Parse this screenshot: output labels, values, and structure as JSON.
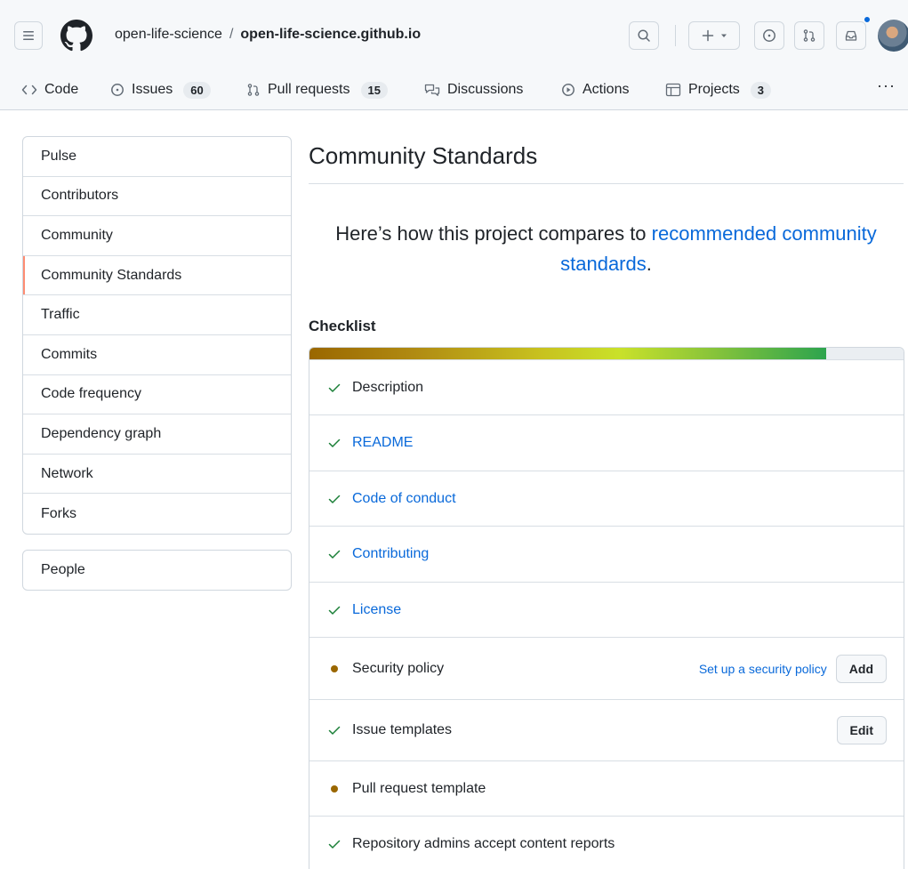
{
  "header": {
    "owner": "open-life-science",
    "separator": "/",
    "repo": "open-life-science.github.io"
  },
  "repo_nav": {
    "code": "Code",
    "issues": "Issues",
    "issues_count": "60",
    "pull_requests": "Pull requests",
    "pull_requests_count": "15",
    "discussions": "Discussions",
    "actions": "Actions",
    "projects": "Projects",
    "projects_count": "3",
    "more": "···"
  },
  "sidebar": {
    "items": [
      {
        "label": "Pulse"
      },
      {
        "label": "Contributors"
      },
      {
        "label": "Community"
      },
      {
        "label": "Community Standards"
      },
      {
        "label": "Traffic"
      },
      {
        "label": "Commits"
      },
      {
        "label": "Code frequency"
      },
      {
        "label": "Dependency graph"
      },
      {
        "label": "Network"
      },
      {
        "label": "Forks"
      }
    ],
    "people": "People"
  },
  "main": {
    "title": "Community Standards",
    "intro_prefix": "Here’s how this project compares to ",
    "intro_link": "recommended community standards",
    "intro_suffix": ".",
    "checklist_heading": "Checklist",
    "progress": 0.87,
    "items": [
      {
        "label": "Description",
        "status": "done"
      },
      {
        "label": "README",
        "status": "done"
      },
      {
        "label": "Code of conduct",
        "status": "done"
      },
      {
        "label": "Contributing",
        "status": "done"
      },
      {
        "label": "License",
        "status": "done"
      },
      {
        "label": "Security policy",
        "status": "missing",
        "action_link": "Set up a security policy",
        "button": "Add"
      },
      {
        "label": "Issue templates",
        "status": "done",
        "button": "Edit"
      },
      {
        "label": "Pull request template",
        "status": "missing"
      },
      {
        "label": "Repository admins accept content reports",
        "status": "done"
      }
    ]
  },
  "colors": {
    "accent": "#0969da",
    "success": "#1a7f37",
    "attention": "#9a6700",
    "selected_bar": "#fd8c73"
  }
}
